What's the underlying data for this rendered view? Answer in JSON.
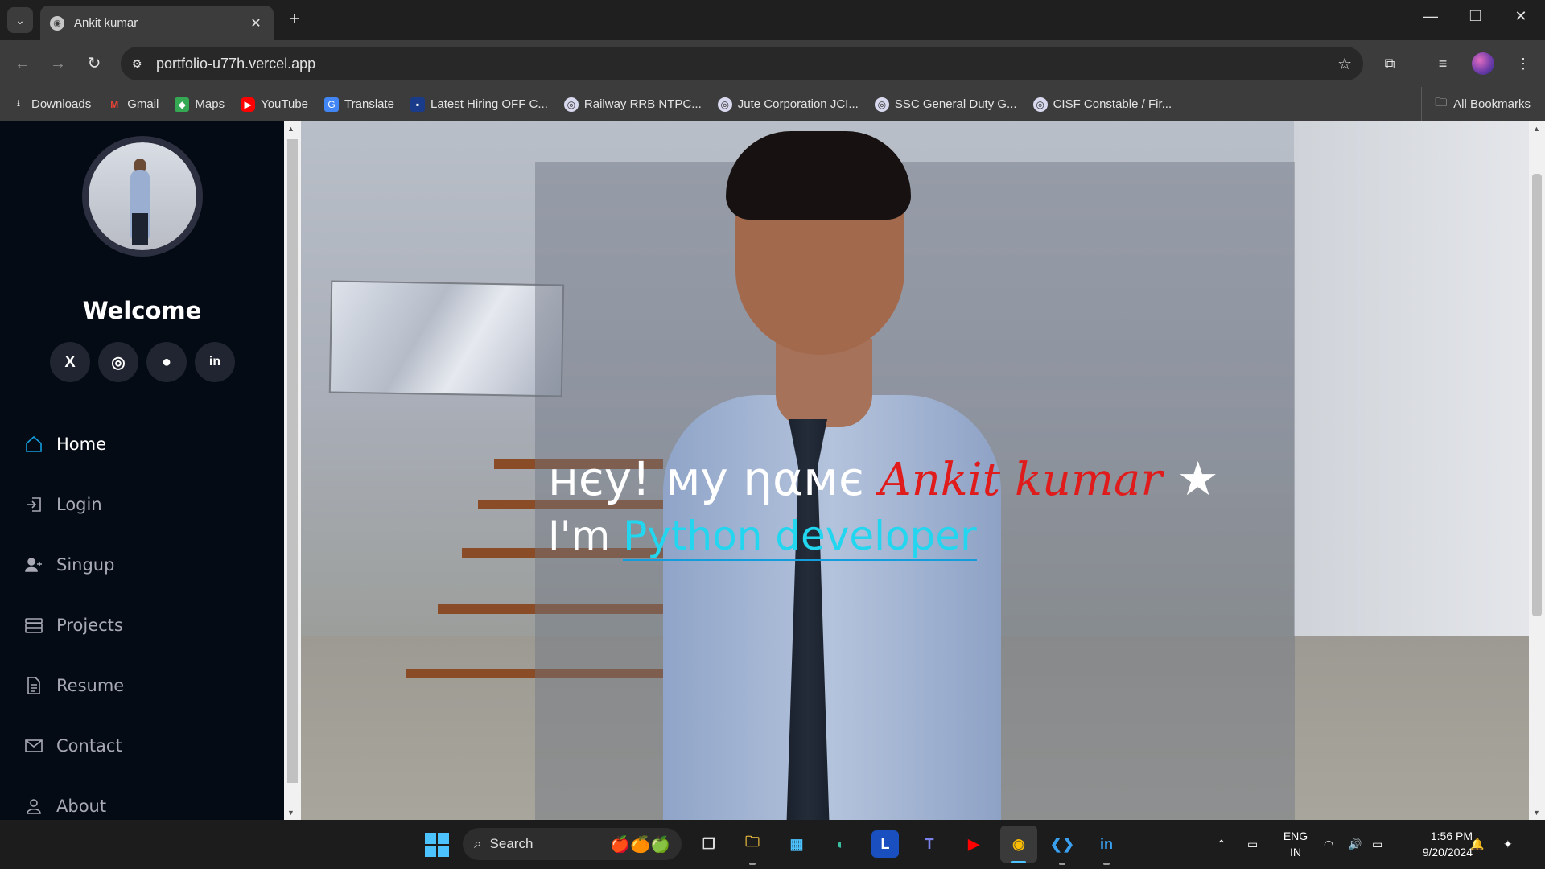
{
  "browser": {
    "tab_title": "Ankit kumar",
    "url": "portfolio-u77h.vercel.app",
    "bookmarks": [
      {
        "label": "Downloads",
        "icon": "download-icon"
      },
      {
        "label": "Gmail",
        "icon": "gmail-icon"
      },
      {
        "label": "Maps",
        "icon": "maps-icon"
      },
      {
        "label": "YouTube",
        "icon": "youtube-icon"
      },
      {
        "label": "Translate",
        "icon": "translate-icon"
      },
      {
        "label": "Latest Hiring OFF C...",
        "icon": "site-icon"
      },
      {
        "label": "Railway RRB NTPC...",
        "icon": "site-icon"
      },
      {
        "label": "Jute Corporation JCI...",
        "icon": "site-icon"
      },
      {
        "label": "SSC General Duty G...",
        "icon": "site-icon"
      },
      {
        "label": "CISF Constable / Fir...",
        "icon": "site-icon"
      }
    ],
    "all_bookmarks": "All Bookmarks"
  },
  "sidebar": {
    "welcome": "Welcome",
    "socials": [
      {
        "name": "x-icon",
        "glyph": "X"
      },
      {
        "name": "instagram-icon",
        "glyph": "◎"
      },
      {
        "name": "github-icon",
        "glyph": "●"
      },
      {
        "name": "linkedin-icon",
        "glyph": "in"
      }
    ],
    "nav": [
      {
        "label": "Home",
        "icon": "home-icon",
        "active": true
      },
      {
        "label": "Login",
        "icon": "login-icon",
        "active": false
      },
      {
        "label": "Singup",
        "icon": "signup-icon",
        "active": false
      },
      {
        "label": "Projects",
        "icon": "projects-icon",
        "active": false
      },
      {
        "label": "Resume",
        "icon": "resume-icon",
        "active": false
      },
      {
        "label": "Contact",
        "icon": "contact-icon",
        "active": false
      },
      {
        "label": "About",
        "icon": "about-icon",
        "active": false
      }
    ]
  },
  "hero": {
    "greeting": "нєу! му ηαмє ",
    "name": "Ankit kumar",
    "star": " ★",
    "role_prefix": "I'm ",
    "role": "Python developer"
  },
  "taskbar": {
    "search": "Search",
    "lang_line1": "ENG",
    "lang_line2": "IN",
    "time": "1:56 PM",
    "date": "9/20/2024"
  },
  "colors": {
    "sidebar_bg": "#040b14",
    "accent": "#149ddd",
    "name_red": "#e01b1b",
    "role_cyan": "#22d6f0"
  }
}
